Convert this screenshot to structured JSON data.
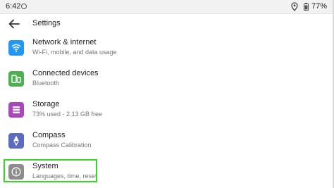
{
  "status_bar": {
    "time": "6:42",
    "battery": "77%",
    "icons": [
      "sync-icon",
      "location-icon",
      "battery-icon"
    ]
  },
  "header": {
    "title": "Settings",
    "back_icon": "back-arrow-icon"
  },
  "items": [
    {
      "title": "Network & internet",
      "subtitle": "Wi-Fi, mobile, and data usage",
      "icon": "wifi-icon",
      "color": "#2196f3"
    },
    {
      "title": "Connected devices",
      "subtitle": "Bluetooth",
      "icon": "devices-icon",
      "color": "#4caf50"
    },
    {
      "title": "Storage",
      "subtitle": "73% used - 2.13 GB free",
      "icon": "storage-icon",
      "color": "#ab47bc"
    },
    {
      "title": "Compass",
      "subtitle": "Compass Calibration",
      "icon": "compass-icon",
      "color": "#5c6bc0"
    },
    {
      "title": "System",
      "subtitle": "Languages, time, reset",
      "icon": "info-icon",
      "color": "#8d8d8d"
    }
  ],
  "highlight_color": "#36d628"
}
